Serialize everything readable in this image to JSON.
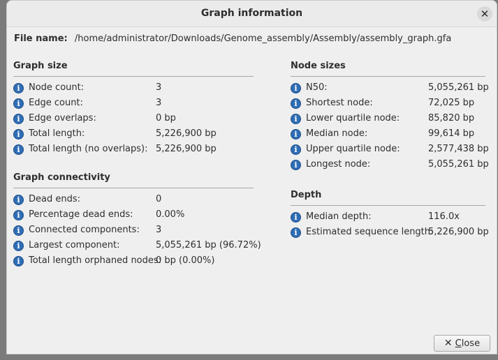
{
  "window": {
    "title": "Graph information",
    "close_icon": "close-icon"
  },
  "file": {
    "label": "File name:",
    "path": "/home/administrator/Downloads/Genome_assembly/Assembly/assembly_graph.gfa"
  },
  "graph_size": {
    "title": "Graph size",
    "rows": [
      {
        "label": "Node count:",
        "value": "3"
      },
      {
        "label": "Edge count:",
        "value": "3"
      },
      {
        "label": "Edge overlaps:",
        "value": "0 bp"
      },
      {
        "label": "Total length:",
        "value": "5,226,900 bp"
      },
      {
        "label": "Total length (no overlaps):",
        "value": "5,226,900 bp"
      }
    ]
  },
  "graph_connectivity": {
    "title": "Graph connectivity",
    "rows": [
      {
        "label": "Dead ends:",
        "value": "0"
      },
      {
        "label": "Percentage dead ends:",
        "value": "0.00%"
      },
      {
        "label": "Connected components:",
        "value": "3"
      },
      {
        "label": "Largest component:",
        "value": "5,055,261 bp (96.72%)"
      },
      {
        "label": "Total length orphaned nodes:",
        "value": "0 bp (0.00%)"
      }
    ]
  },
  "node_sizes": {
    "title": "Node sizes",
    "rows": [
      {
        "label": "N50:",
        "value": "5,055,261 bp"
      },
      {
        "label": "Shortest node:",
        "value": "72,025 bp"
      },
      {
        "label": "Lower quartile node:",
        "value": "85,820 bp"
      },
      {
        "label": "Median node:",
        "value": "99,614 bp"
      },
      {
        "label": "Upper quartile node:",
        "value": "2,577,438 bp"
      },
      {
        "label": "Longest node:",
        "value": "5,055,261 bp"
      }
    ]
  },
  "depth": {
    "title": "Depth",
    "rows": [
      {
        "label": "Median depth:",
        "value": "116.0x"
      },
      {
        "label": "Estimated sequence length:",
        "value": "5,226,900 bp"
      }
    ]
  },
  "buttons": {
    "close_label_prefix": "",
    "close_label_u": "C",
    "close_label_rest": "lose"
  },
  "icons": {
    "info": "info-icon",
    "button_close": "close-x-icon"
  },
  "colors": {
    "info_icon": "#2f6db5",
    "background": "#efefef"
  }
}
